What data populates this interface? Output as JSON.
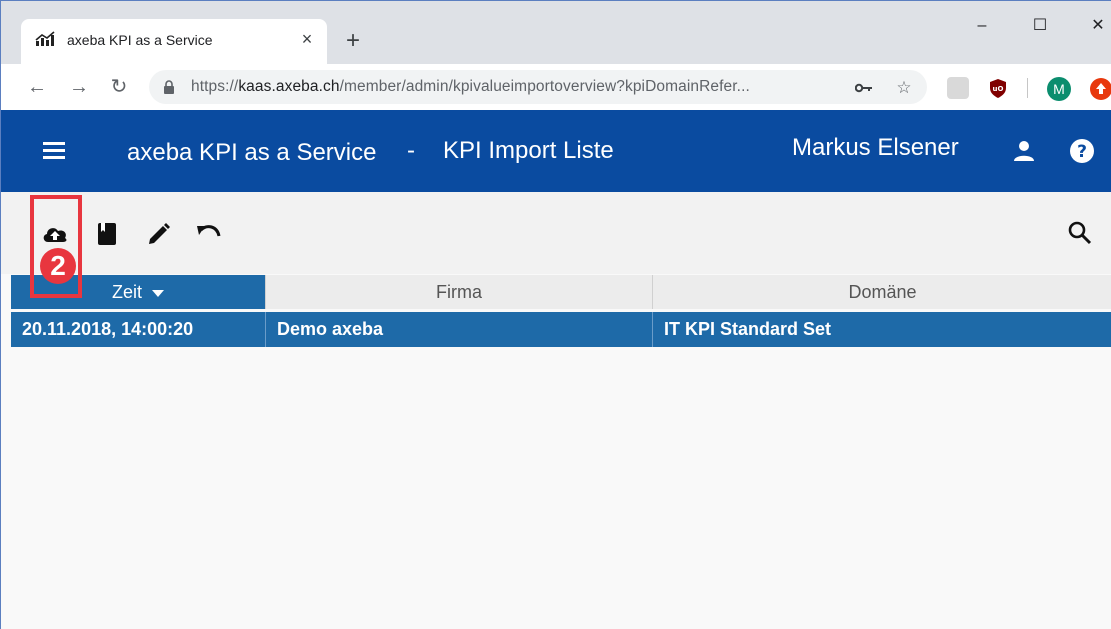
{
  "browser": {
    "tab_title": "axeba KPI as a Service",
    "tab_close": "×",
    "new_tab": "+",
    "url_prefix": "https://",
    "url_host": "kaas.axeba.ch",
    "url_path": "/member/admin/kpivalueimportoverview?kpiDomainRefer...",
    "window_minimize": "–",
    "window_maximize": "☐",
    "window_close": "✕",
    "profile_initial": "M"
  },
  "app": {
    "title": "axeba KPI as a Service",
    "separator": "-",
    "page": "KPI Import Liste",
    "user_name": "Markus Elsener",
    "accent_color": "#0a4ba0",
    "selected_row_color": "#1e6aa8"
  },
  "actions": {
    "icons": [
      "cloud-upload-icon",
      "book-icon",
      "pencil-icon",
      "undo-icon",
      "search-icon"
    ],
    "badge": "2"
  },
  "table": {
    "columns": [
      {
        "label": "Zeit",
        "sorted": "desc"
      },
      {
        "label": "Firma"
      },
      {
        "label": "Domäne"
      }
    ],
    "rows": [
      {
        "zeit": "20.11.2018, 14:00:20",
        "firma": "Demo axeba",
        "domaene": "IT KPI Standard Set",
        "selected": true
      }
    ]
  }
}
